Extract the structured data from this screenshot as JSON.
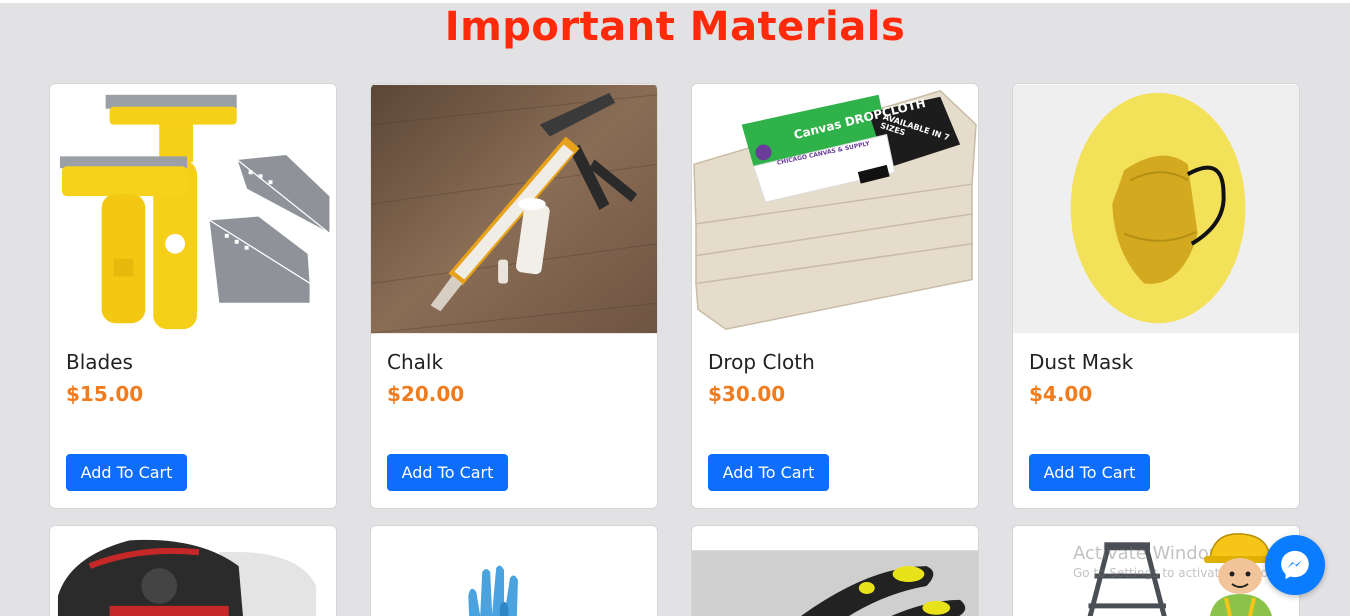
{
  "page": {
    "title": "Important Materials"
  },
  "colors": {
    "title": "#ff2a0a",
    "price": "#f07c20",
    "button": "#0d6efd",
    "messenger": "#0a7cff"
  },
  "products": [
    {
      "name": "Blades",
      "price": "$15.00",
      "button": "Add To Cart"
    },
    {
      "name": "Chalk",
      "price": "$20.00",
      "button": "Add To Cart"
    },
    {
      "name": "Drop Cloth",
      "price": "$30.00",
      "button": "Add To Cart"
    },
    {
      "name": "Dust Mask",
      "price": "$4.00",
      "button": "Add To Cart"
    }
  ],
  "dropcloth_label": {
    "brand": "Canvas DROPCLOTH",
    "badge": "AVAILABLE IN 7 SIZES",
    "company": "CHICAGO CANVAS & SUPPLY"
  },
  "watermark": {
    "line1": "Activate Windows",
    "line2": "Go to Settings to activate Windows."
  },
  "icons": {
    "chat": "messenger-icon"
  }
}
